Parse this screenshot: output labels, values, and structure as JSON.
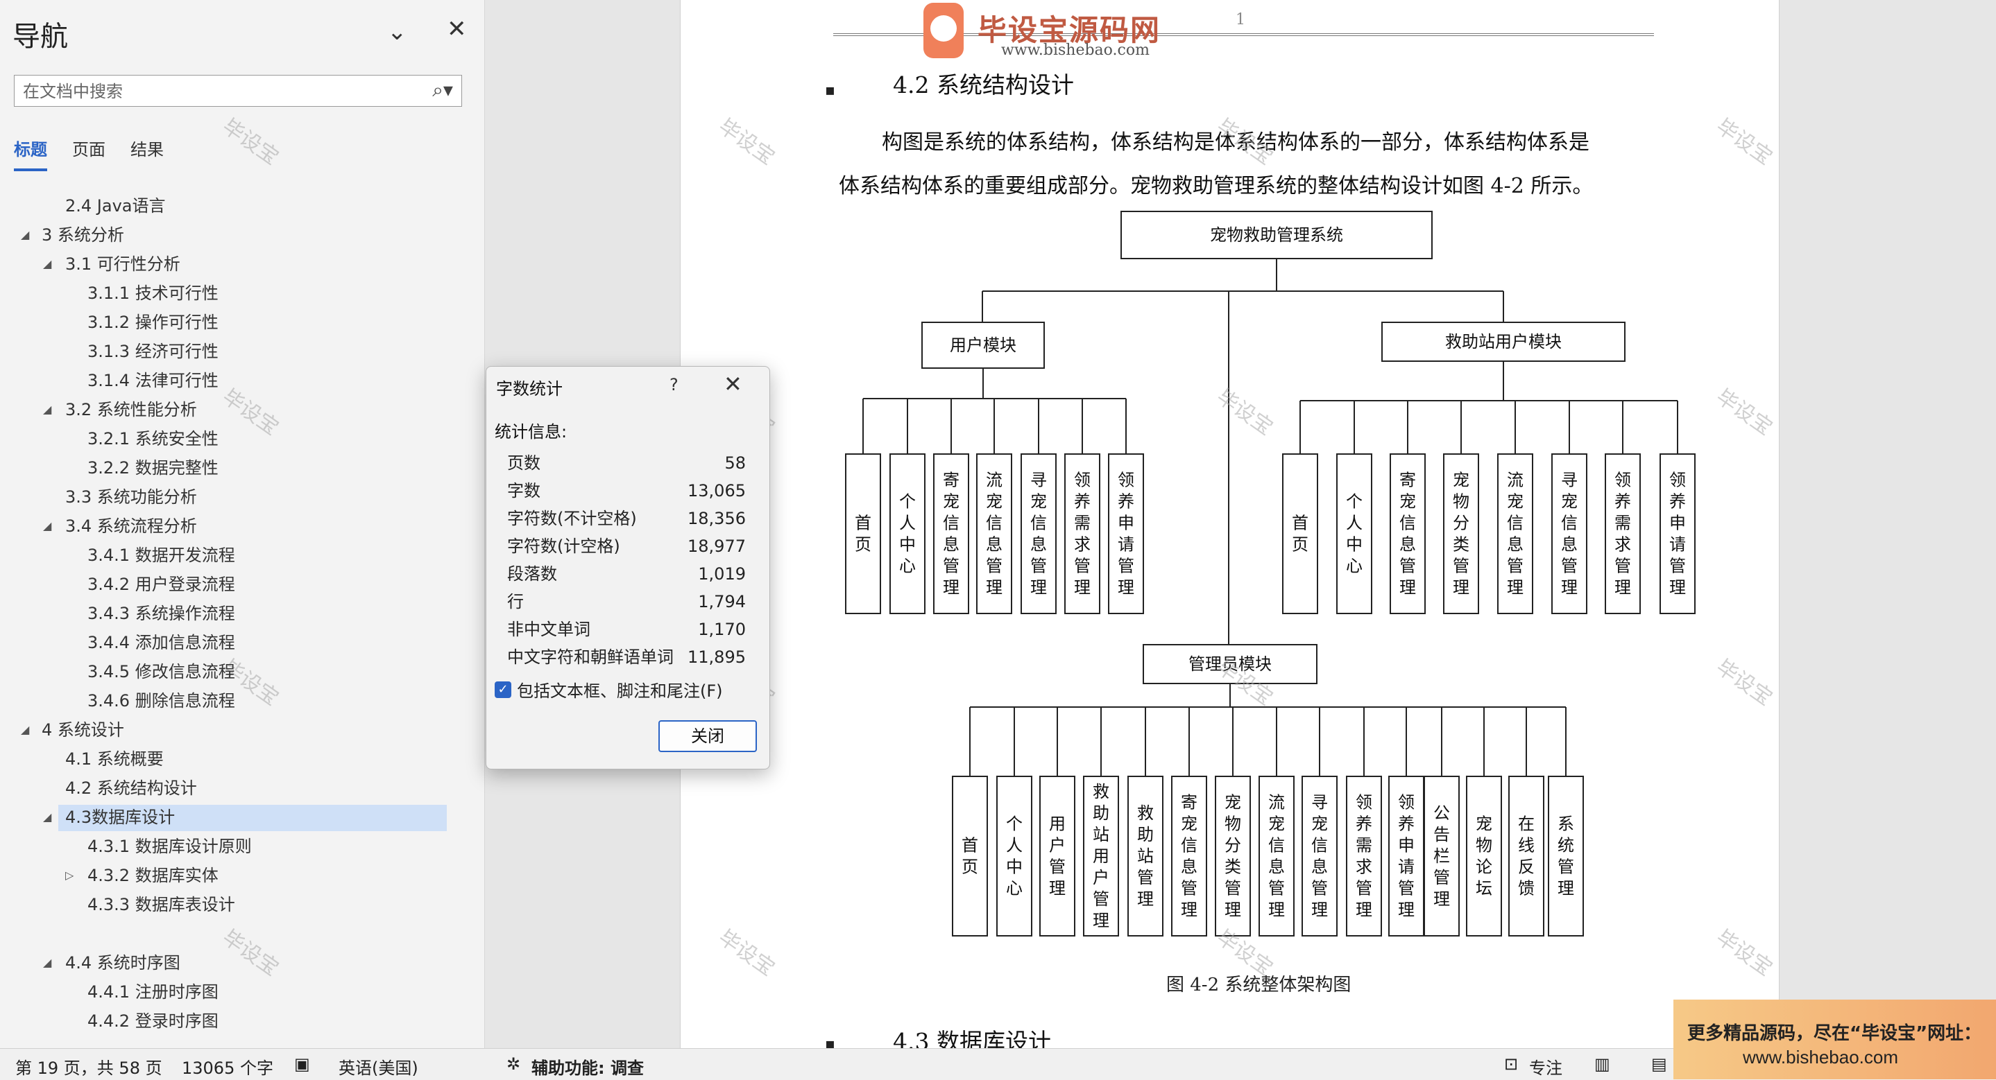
{
  "nav": {
    "title": "导航",
    "collapse_icon": "chevron-down-icon",
    "close_icon": "close-icon",
    "search_placeholder": "在文档中搜索",
    "tabs": [
      "标题",
      "页面",
      "结果"
    ],
    "active_tab": "标题",
    "items": [
      {
        "level": 2,
        "toggle": "",
        "label": "2.4 Java语言"
      },
      {
        "level": 1,
        "toggle": "◢",
        "label": "3 系统分析"
      },
      {
        "level": 2,
        "toggle": "◢",
        "label": "3.1 可行性分析"
      },
      {
        "level": 3,
        "toggle": "",
        "label": "3.1.1 技术可行性"
      },
      {
        "level": 3,
        "toggle": "",
        "label": "3.1.2 操作可行性"
      },
      {
        "level": 3,
        "toggle": "",
        "label": "3.1.3 经济可行性"
      },
      {
        "level": 3,
        "toggle": "",
        "label": "3.1.4 法律可行性"
      },
      {
        "level": 2,
        "toggle": "◢",
        "label": "3.2 系统性能分析"
      },
      {
        "level": 3,
        "toggle": "",
        "label": "3.2.1 系统安全性"
      },
      {
        "level": 3,
        "toggle": "",
        "label": "3.2.2 数据完整性"
      },
      {
        "level": 2,
        "toggle": "",
        "label": "3.3 系统功能分析"
      },
      {
        "level": 2,
        "toggle": "◢",
        "label": "3.4 系统流程分析"
      },
      {
        "level": 3,
        "toggle": "",
        "label": "3.4.1 数据开发流程"
      },
      {
        "level": 3,
        "toggle": "",
        "label": "3.4.2 用户登录流程"
      },
      {
        "level": 3,
        "toggle": "",
        "label": "3.4.3 系统操作流程"
      },
      {
        "level": 3,
        "toggle": "",
        "label": "3.4.4 添加信息流程"
      },
      {
        "level": 3,
        "toggle": "",
        "label": "3.4.5 修改信息流程"
      },
      {
        "level": 3,
        "toggle": "",
        "label": "3.4.6 删除信息流程"
      },
      {
        "level": 1,
        "toggle": "◢",
        "label": "4 系统设计"
      },
      {
        "level": 2,
        "toggle": "",
        "label": "4.1 系统概要"
      },
      {
        "level": 2,
        "toggle": "",
        "label": "4.2 系统结构设计"
      },
      {
        "level": 2,
        "toggle": "◢",
        "label": "4.3数据库设计",
        "selected": true
      },
      {
        "level": 3,
        "toggle": "",
        "label": "4.3.1 数据库设计原则"
      },
      {
        "level": 3,
        "toggle": "▷",
        "label": "4.3.2 数据库实体"
      },
      {
        "level": 3,
        "toggle": "",
        "label": "4.3.3 数据库表设计"
      },
      {
        "level": 0,
        "toggle": "",
        "label": ""
      },
      {
        "level": 2,
        "toggle": "◢",
        "label": "4.4 系统时序图"
      },
      {
        "level": 3,
        "toggle": "",
        "label": "4.4.1 注册时序图"
      },
      {
        "level": 3,
        "toggle": "",
        "label": "4.4.2 登录时序图"
      }
    ]
  },
  "doc": {
    "page_number": "1",
    "header_logo_text": "毕设宝源码网",
    "header_logo_badge": "毕设宝",
    "header_url": "www.bishebao.com",
    "heading_42": "4.2  系统结构设计",
    "para_line1": "构图是系统的体系结构，体系结构是体系结构体系的一部分，体系结构体系是",
    "para_line2": "体系结构体系的重要组成部分。宠物救助管理系统的整体结构设计如图 4-2 所示。",
    "caption": "图 4-2  系统整体架构图",
    "heading_43": "4.3 数据库设计",
    "watermark": "毕设宝"
  },
  "diagram": {
    "root": "宠物救助管理系统",
    "user_module": {
      "name": "用户模块",
      "children": [
        "首页",
        "个人中心",
        "寄宠信息管理",
        "流宠信息管理",
        "寻宠信息管理",
        "领养需求管理",
        "领养申请管理"
      ]
    },
    "station_module": {
      "name": "救助站用户模块",
      "children": [
        "首页",
        "个人中心",
        "寄宠信息管理",
        "宠物分类管理",
        "流宠信息管理",
        "寻宠信息管理",
        "领养需求管理",
        "领养申请管理"
      ]
    },
    "admin_module": {
      "name": "管理员模块",
      "children": [
        "首页",
        "个人中心",
        "用户管理",
        "救助站用户管理",
        "救助站管理",
        "寄宠信息管理",
        "宠物分类管理",
        "流宠信息管理",
        "寻宠信息管理",
        "领养需求管理",
        "领养申请管理",
        "公告栏管理",
        "宠物论坛",
        "在线反馈",
        "系统管理"
      ]
    }
  },
  "dialog": {
    "title": "字数统计",
    "help": "?",
    "stats_heading": "统计信息:",
    "stats": [
      {
        "label": "页数",
        "value": "58"
      },
      {
        "label": "字数",
        "value": "13,065"
      },
      {
        "label": "字符数(不计空格)",
        "value": "18,356"
      },
      {
        "label": "字符数(计空格)",
        "value": "18,977"
      },
      {
        "label": "段落数",
        "value": "1,019"
      },
      {
        "label": "行",
        "value": "1,794"
      },
      {
        "label": "非中文单词",
        "value": "1,170"
      },
      {
        "label": "中文字符和朝鲜语单词",
        "value": "11,895"
      }
    ],
    "checkbox_label": "包括文本框、脚注和尾注(F)",
    "checkbox_checked": true,
    "close_button": "关闭"
  },
  "status": {
    "page": "第 19 页，共 58 页",
    "words": "13065 个字",
    "language": "英语(美国)",
    "accessibility": "辅助功能: 调查",
    "focus": "专注"
  },
  "ad": {
    "line1": "更多精品源码，尽在“毕设宝”网址：",
    "line2": "www.bishebao.com"
  },
  "colors": {
    "accent": "#2b64c6",
    "selection": "#cfe0f7",
    "ad_bg": "#f4b87a"
  }
}
